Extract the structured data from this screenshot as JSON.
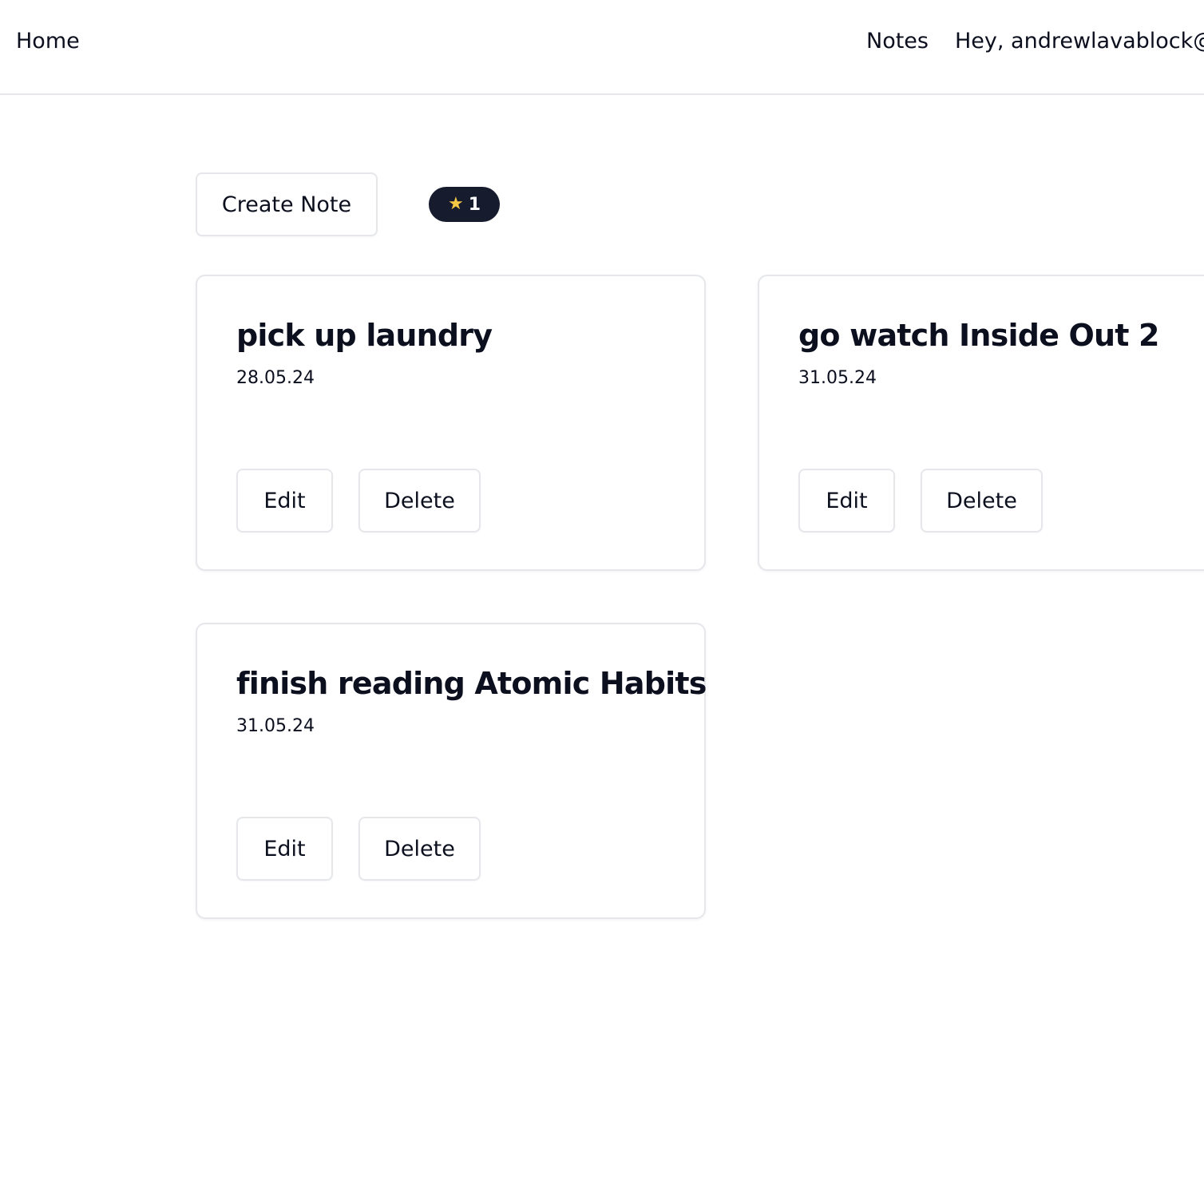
{
  "nav": {
    "home": "Home",
    "notes": "Notes",
    "greeting": "Hey, andrewlavablock@"
  },
  "toolbar": {
    "create_label": "Create Note",
    "star_icon": "star-icon",
    "star_count": "1"
  },
  "notes": [
    {
      "title": "pick up laundry",
      "date": "28.05.24",
      "edit_label": "Edit",
      "delete_label": "Delete"
    },
    {
      "title": "go watch Inside Out 2",
      "date": "31.05.24",
      "edit_label": "Edit",
      "delete_label": "Delete"
    },
    {
      "title": "finish reading Atomic Habits",
      "date": "31.05.24",
      "edit_label": "Edit",
      "delete_label": "Delete"
    }
  ],
  "colors": {
    "text": "#0b0f1e",
    "badge_bg": "#161b2e",
    "star": "#f7c845",
    "border": "#e5e7eb"
  }
}
